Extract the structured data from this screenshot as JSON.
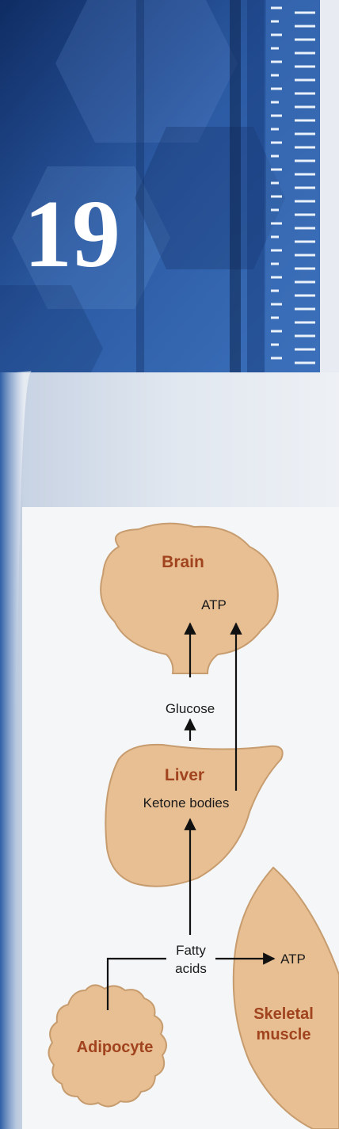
{
  "chapter": {
    "number": "19"
  },
  "organs": {
    "brain": "Brain",
    "liver": "Liver",
    "adipocyte": "Adipocyte",
    "skeletal_muscle_line1": "Skeletal",
    "skeletal_muscle_line2": "muscle"
  },
  "metabolites": {
    "atp_brain": "ATP",
    "glucose": "Glucose",
    "ketone_bodies": "Ketone bodies",
    "fatty_acids_line1": "Fatty",
    "fatty_acids_line2": "acids",
    "atp_muscle": "ATP"
  },
  "colors": {
    "cover_blue_dark": "#10316b",
    "cover_blue": "#2e5fa8",
    "organ_fill": "#e7bf92",
    "organ_stroke": "#c79c6f",
    "organ_label": "#a0431e",
    "arrow": "#111111",
    "panel": "#f4f6f7"
  }
}
